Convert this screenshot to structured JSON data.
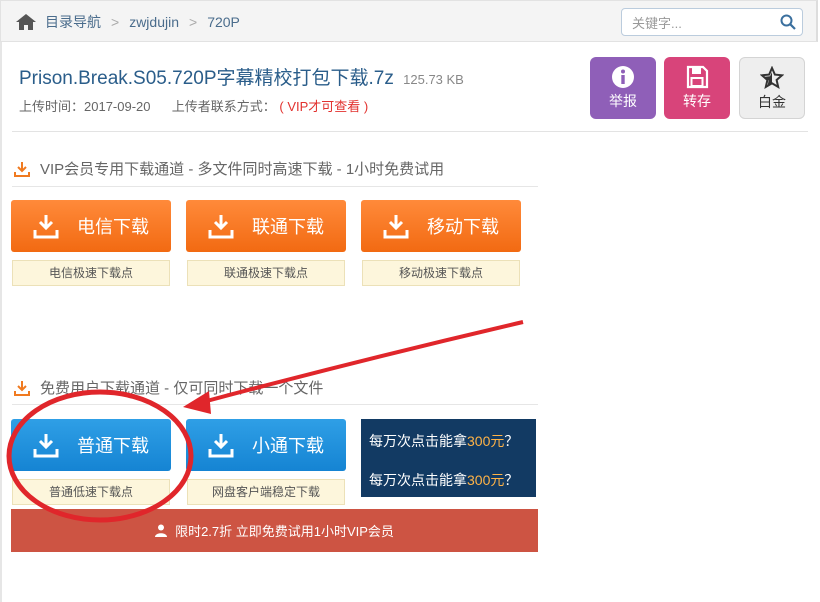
{
  "breadcrumb": {
    "items": [
      "目录导航",
      "zwjdujin",
      "720P"
    ],
    "separator": ">"
  },
  "search": {
    "placeholder": "关键字..."
  },
  "file": {
    "name": "Prison.Break.S05.720P字幕精校打包下载.7z",
    "size": "125.73 KB",
    "upload_label": "上传时间：2017-09-20",
    "contact_label": "上传者联系方式：",
    "contact_value": "( VIP才可查看 )"
  },
  "actions": {
    "report": "举报",
    "save": "转存",
    "free": "白金"
  },
  "vip_section": {
    "title": "VIP会员专用下载通道 - 多文件同时高速下载 - 1小时免费试用",
    "buttons": [
      {
        "label": "电信下载",
        "sub": "电信极速下载点"
      },
      {
        "label": "联通下载",
        "sub": "联通极速下载点"
      },
      {
        "label": "移动下载",
        "sub": "移动极速下载点"
      }
    ]
  },
  "free_section": {
    "title": "免费用户下载通道 - 仅可同时下载一个文件",
    "buttons": [
      {
        "label": "普通下载",
        "sub": "普通低速下载点"
      },
      {
        "label": "小通下载",
        "sub": "网盘客户端稳定下载"
      }
    ]
  },
  "ad": {
    "line1_prefix": "每万次点击能拿",
    "line1_amount": "300元",
    "line1_suffix": "？",
    "line2_prefix": "每万次点击能拿",
    "line2_amount": "300元",
    "line2_suffix": "？"
  },
  "promo": {
    "label": "限时2.7折 立即免费试用1小时VIP会员"
  },
  "colors": {
    "accent_orange": "#f26a12",
    "accent_blue": "#1584d3",
    "annotation_red": "#e0262b",
    "promo_red": "#cd5443"
  },
  "icons": {
    "home": "home-icon",
    "search": "search-icon",
    "report": "info-icon",
    "save": "save-disk-icon",
    "free": "star-icon",
    "download": "download-icon",
    "user": "user-icon"
  }
}
